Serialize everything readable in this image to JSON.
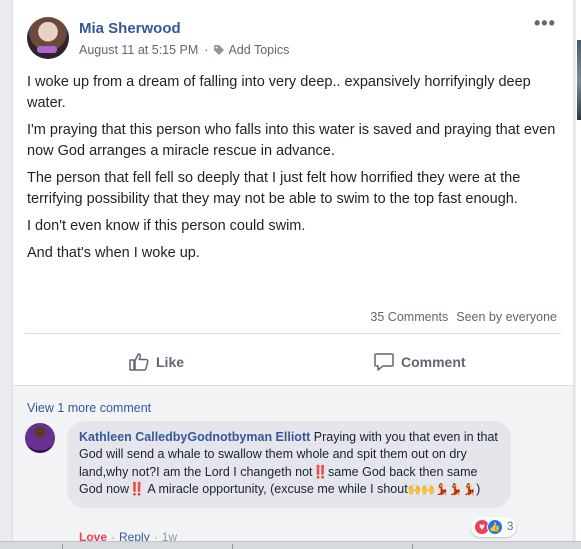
{
  "post": {
    "author": "Mia Sherwood",
    "date": "August 11 at 5:15 PM",
    "separator": "·",
    "add_topics": "Add Topics",
    "more_label": "•••",
    "paragraphs": [
      "I woke up from a dream of falling into very deep.. expansively horrifyingly deep water.",
      "I'm praying that this person who falls into this water is saved and praying that even now God arranges a miracle rescue in advance.",
      "The person that fell fell so deeply that I just felt how horrified they were at the terrifying possibility that they may not be able to swim to the top fast enough.",
      "I don't even know if this person could swim.",
      "And that's when I woke up."
    ],
    "comments_count": "35 Comments",
    "seen_by": "Seen by everyone"
  },
  "actions": {
    "like": "Like",
    "comment": "Comment"
  },
  "comments": {
    "view_more": "View 1 more comment",
    "items": [
      {
        "author": "Kathleen CalledbyGodnotbyman Elliott",
        "text": " Praying with you that even in that God will send a whale to swallow them whole and spit them out on dry land,why not?I am the Lord I changeth not‼️same God back then same God now‼️ A miracle opportunity, (excuse me while I shout",
        "emoji": "🙌🙌💃💃💃",
        "text_end": ")",
        "reaction_count": "3",
        "love_label": "Love",
        "reply_label": "Reply",
        "time": "1w"
      }
    ]
  },
  "colors": {
    "link": "#365899",
    "love": "#f33e58",
    "like": "#1877f2"
  },
  "icons": {
    "more": "more-icon",
    "tag": "tag-icon",
    "like": "thumbs-up-icon",
    "comment": "speech-bubble-icon",
    "love_reaction": "heart-icon",
    "like_reaction": "like-icon"
  }
}
